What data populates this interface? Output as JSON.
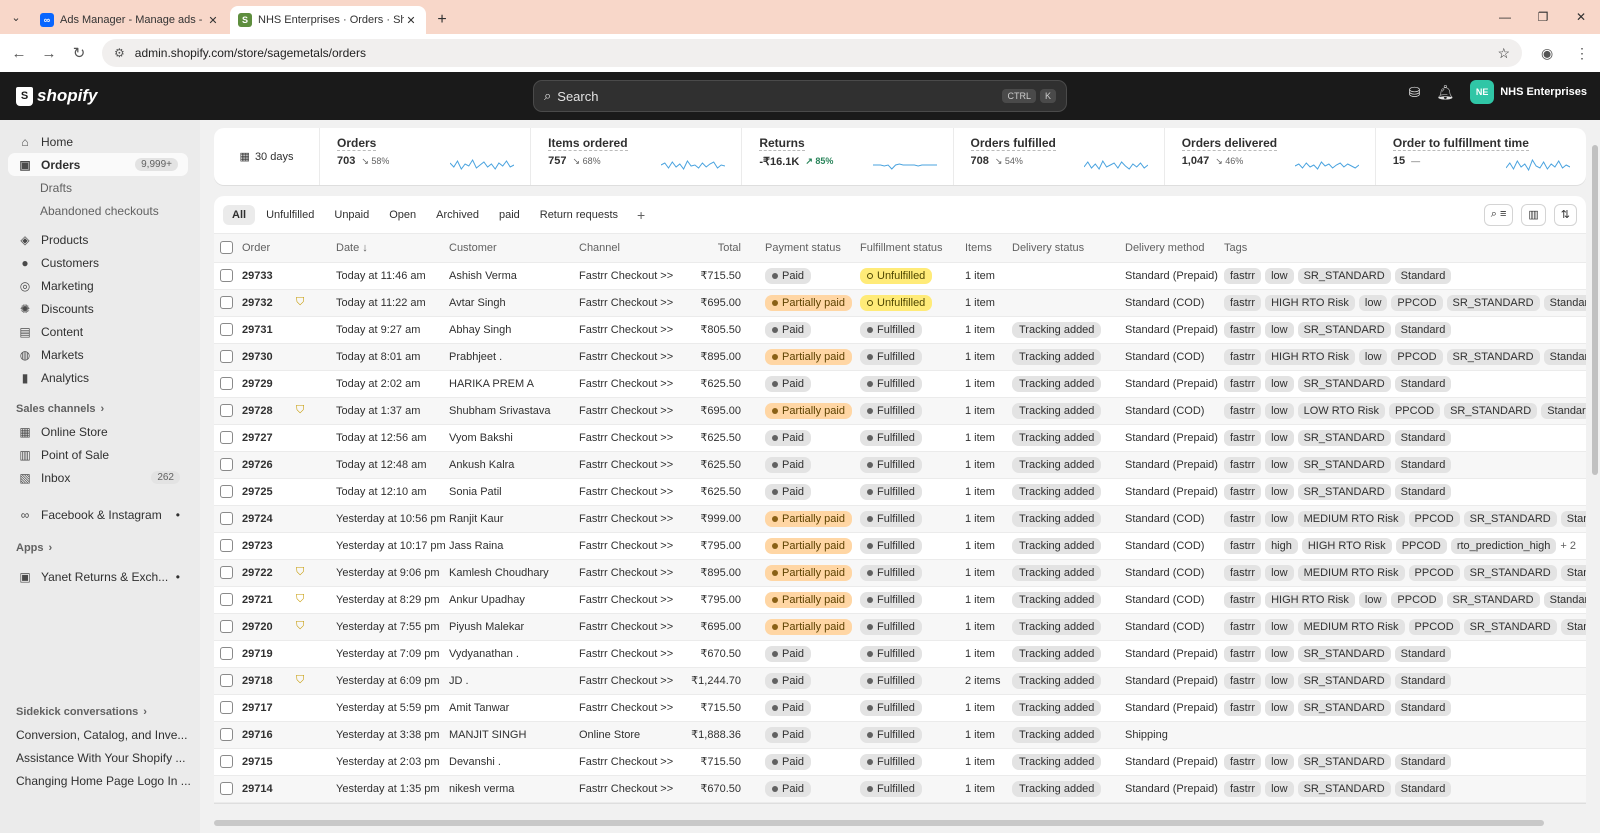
{
  "browser": {
    "tabs": [
      {
        "title": "Ads Manager - Manage ads - C",
        "active": false
      },
      {
        "title": "NHS Enterprises · Orders · Shop",
        "active": true
      }
    ],
    "url": "admin.shopify.com/store/sagemetals/orders"
  },
  "topbar": {
    "logo": "shopify",
    "search_placeholder": "Search",
    "kbd1": "CTRL",
    "kbd2": "K",
    "store_initials": "NE",
    "store_name": "NHS Enterprises"
  },
  "sidebar": {
    "home": "Home",
    "orders": "Orders",
    "orders_badge": "9,999+",
    "drafts": "Drafts",
    "abandoned": "Abandoned checkouts",
    "products": "Products",
    "customers": "Customers",
    "marketing": "Marketing",
    "discounts": "Discounts",
    "content": "Content",
    "markets": "Markets",
    "analytics": "Analytics",
    "sales_channels": "Sales channels",
    "online_store": "Online Store",
    "pos": "Point of Sale",
    "inbox": "Inbox",
    "inbox_badge": "262",
    "facebook": "Facebook & Instagram",
    "apps": "Apps",
    "yanet": "Yanet Returns & Exch...",
    "sidekick": "Sidekick conversations",
    "conv1": "Conversion, Catalog, and Inve...",
    "conv2": "Assistance With Your Shopify ...",
    "conv3": "Changing Home Page Logo In ..."
  },
  "metrics": {
    "range": "30 days",
    "items": [
      {
        "title": "Orders",
        "value": "703",
        "pct": "58%",
        "up": false
      },
      {
        "title": "Items ordered",
        "value": "757",
        "pct": "68%",
        "up": false
      },
      {
        "title": "Returns",
        "value": "-₹16.1K",
        "pct": "85%",
        "up": true
      },
      {
        "title": "Orders fulfilled",
        "value": "708",
        "pct": "54%",
        "up": false
      },
      {
        "title": "Orders delivered",
        "value": "1,047",
        "pct": "46%",
        "up": false
      },
      {
        "title": "Order to fulfillment time",
        "value": "15",
        "pct": "—",
        "up": false
      }
    ]
  },
  "filters": [
    "All",
    "Unfulfilled",
    "Unpaid",
    "Open",
    "Archived",
    "paid",
    "Return requests"
  ],
  "columns": {
    "order": "Order",
    "date": "Date ↓",
    "customer": "Customer",
    "channel": "Channel",
    "total": "Total",
    "payment": "Payment status",
    "fulfillment": "Fulfillment status",
    "items": "Items",
    "delivery": "Delivery status",
    "method": "Delivery method",
    "tags": "Tags"
  },
  "orders": [
    {
      "num": "29733",
      "flag": false,
      "date": "Today at 11:46 am",
      "customer": "Ashish Verma",
      "channel": "Fastrr Checkout >>",
      "total": "₹715.50",
      "payment": "Paid",
      "fulfillment": "Unfulfilled",
      "items": "1 item",
      "delivery": "",
      "method": "Standard (Prepaid)",
      "tags": [
        "fastrr",
        "low",
        "SR_STANDARD",
        "Standard"
      ],
      "more": ""
    },
    {
      "num": "29732",
      "flag": true,
      "date": "Today at 11:22 am",
      "customer": "Avtar Singh",
      "channel": "Fastrr Checkout >>",
      "total": "₹695.00",
      "payment": "Partially paid",
      "fulfillment": "Unfulfilled",
      "items": "1 item",
      "delivery": "",
      "method": "Standard (COD)",
      "tags": [
        "fastrr",
        "HIGH RTO Risk",
        "low",
        "PPCOD",
        "SR_STANDARD",
        "Standard"
      ],
      "more": ""
    },
    {
      "num": "29731",
      "flag": false,
      "date": "Today at 9:27 am",
      "customer": "Abhay Singh",
      "channel": "Fastrr Checkout >>",
      "total": "₹805.50",
      "payment": "Paid",
      "fulfillment": "Fulfilled",
      "items": "1 item",
      "delivery": "Tracking added",
      "method": "Standard (Prepaid)",
      "tags": [
        "fastrr",
        "low",
        "SR_STANDARD",
        "Standard"
      ],
      "more": ""
    },
    {
      "num": "29730",
      "flag": false,
      "date": "Today at 8:01 am",
      "customer": "Prabhjeet .",
      "channel": "Fastrr Checkout >>",
      "total": "₹895.00",
      "payment": "Partially paid",
      "fulfillment": "Fulfilled",
      "items": "1 item",
      "delivery": "Tracking added",
      "method": "Standard (COD)",
      "tags": [
        "fastrr",
        "HIGH RTO Risk",
        "low",
        "PPCOD",
        "SR_STANDARD",
        "Standard"
      ],
      "more": ""
    },
    {
      "num": "29729",
      "flag": false,
      "date": "Today at 2:02 am",
      "customer": "HARIKA PREM A",
      "channel": "Fastrr Checkout >>",
      "total": "₹625.50",
      "payment": "Paid",
      "fulfillment": "Fulfilled",
      "items": "1 item",
      "delivery": "Tracking added",
      "method": "Standard (Prepaid)",
      "tags": [
        "fastrr",
        "low",
        "SR_STANDARD",
        "Standard"
      ],
      "more": ""
    },
    {
      "num": "29728",
      "flag": true,
      "date": "Today at 1:37 am",
      "customer": "Shubham Srivastava",
      "channel": "Fastrr Checkout >>",
      "total": "₹695.00",
      "payment": "Partially paid",
      "fulfillment": "Fulfilled",
      "items": "1 item",
      "delivery": "Tracking added",
      "method": "Standard (COD)",
      "tags": [
        "fastrr",
        "low",
        "LOW RTO Risk",
        "PPCOD",
        "SR_STANDARD",
        "Standard"
      ],
      "more": ""
    },
    {
      "num": "29727",
      "flag": false,
      "date": "Today at 12:56 am",
      "customer": "Vyom Bakshi",
      "channel": "Fastrr Checkout >>",
      "total": "₹625.50",
      "payment": "Paid",
      "fulfillment": "Fulfilled",
      "items": "1 item",
      "delivery": "Tracking added",
      "method": "Standard (Prepaid)",
      "tags": [
        "fastrr",
        "low",
        "SR_STANDARD",
        "Standard"
      ],
      "more": ""
    },
    {
      "num": "29726",
      "flag": false,
      "date": "Today at 12:48 am",
      "customer": "Ankush Kalra",
      "channel": "Fastrr Checkout >>",
      "total": "₹625.50",
      "payment": "Paid",
      "fulfillment": "Fulfilled",
      "items": "1 item",
      "delivery": "Tracking added",
      "method": "Standard (Prepaid)",
      "tags": [
        "fastrr",
        "low",
        "SR_STANDARD",
        "Standard"
      ],
      "more": ""
    },
    {
      "num": "29725",
      "flag": false,
      "date": "Today at 12:10 am",
      "customer": "Sonia Patil",
      "channel": "Fastrr Checkout >>",
      "total": "₹625.50",
      "payment": "Paid",
      "fulfillment": "Fulfilled",
      "items": "1 item",
      "delivery": "Tracking added",
      "method": "Standard (Prepaid)",
      "tags": [
        "fastrr",
        "low",
        "SR_STANDARD",
        "Standard"
      ],
      "more": ""
    },
    {
      "num": "29724",
      "flag": false,
      "date": "Yesterday at 10:56 pm",
      "customer": "Ranjit Kaur",
      "channel": "Fastrr Checkout >>",
      "total": "₹999.00",
      "payment": "Partially paid",
      "fulfillment": "Fulfilled",
      "items": "1 item",
      "delivery": "Tracking added",
      "method": "Standard (COD)",
      "tags": [
        "fastrr",
        "low",
        "MEDIUM RTO Risk",
        "PPCOD",
        "SR_STANDARD",
        "Stand"
      ],
      "more": ""
    },
    {
      "num": "29723",
      "flag": false,
      "date": "Yesterday at 10:17 pm",
      "customer": "Jass Raina",
      "channel": "Fastrr Checkout >>",
      "total": "₹795.00",
      "payment": "Partially paid",
      "fulfillment": "Fulfilled",
      "items": "1 item",
      "delivery": "Tracking added",
      "method": "Standard (COD)",
      "tags": [
        "fastrr",
        "high",
        "HIGH RTO Risk",
        "PPCOD",
        "rto_prediction_high"
      ],
      "more": "+ 2"
    },
    {
      "num": "29722",
      "flag": true,
      "date": "Yesterday at 9:06 pm",
      "customer": "Kamlesh Choudhary",
      "channel": "Fastrr Checkout >>",
      "total": "₹895.00",
      "payment": "Partially paid",
      "fulfillment": "Fulfilled",
      "items": "1 item",
      "delivery": "Tracking added",
      "method": "Standard (COD)",
      "tags": [
        "fastrr",
        "low",
        "MEDIUM RTO Risk",
        "PPCOD",
        "SR_STANDARD",
        "Stand"
      ],
      "more": ""
    },
    {
      "num": "29721",
      "flag": true,
      "date": "Yesterday at 8:29 pm",
      "customer": "Ankur Upadhay",
      "channel": "Fastrr Checkout >>",
      "total": "₹795.00",
      "payment": "Partially paid",
      "fulfillment": "Fulfilled",
      "items": "1 item",
      "delivery": "Tracking added",
      "method": "Standard (COD)",
      "tags": [
        "fastrr",
        "HIGH RTO Risk",
        "low",
        "PPCOD",
        "SR_STANDARD",
        "Standard"
      ],
      "more": ""
    },
    {
      "num": "29720",
      "flag": true,
      "date": "Yesterday at 7:55 pm",
      "customer": "Piyush Malekar",
      "channel": "Fastrr Checkout >>",
      "total": "₹695.00",
      "payment": "Partially paid",
      "fulfillment": "Fulfilled",
      "items": "1 item",
      "delivery": "Tracking added",
      "method": "Standard (COD)",
      "tags": [
        "fastrr",
        "low",
        "MEDIUM RTO Risk",
        "PPCOD",
        "SR_STANDARD",
        "Stand"
      ],
      "more": ""
    },
    {
      "num": "29719",
      "flag": false,
      "date": "Yesterday at 7:09 pm",
      "customer": "Vydyanathan .",
      "channel": "Fastrr Checkout >>",
      "total": "₹670.50",
      "payment": "Paid",
      "fulfillment": "Fulfilled",
      "items": "1 item",
      "delivery": "Tracking added",
      "method": "Standard (Prepaid)",
      "tags": [
        "fastrr",
        "low",
        "SR_STANDARD",
        "Standard"
      ],
      "more": ""
    },
    {
      "num": "29718",
      "flag": true,
      "date": "Yesterday at 6:09 pm",
      "customer": "JD .",
      "channel": "Fastrr Checkout >>",
      "total": "₹1,244.70",
      "payment": "Paid",
      "fulfillment": "Fulfilled",
      "items": "2 items",
      "delivery": "Tracking added",
      "method": "Standard (Prepaid)",
      "tags": [
        "fastrr",
        "low",
        "SR_STANDARD",
        "Standard"
      ],
      "more": ""
    },
    {
      "num": "29717",
      "flag": false,
      "date": "Yesterday at 5:59 pm",
      "customer": "Amit Tanwar",
      "channel": "Fastrr Checkout >>",
      "total": "₹715.50",
      "payment": "Paid",
      "fulfillment": "Fulfilled",
      "items": "1 item",
      "delivery": "Tracking added",
      "method": "Standard (Prepaid)",
      "tags": [
        "fastrr",
        "low",
        "SR_STANDARD",
        "Standard"
      ],
      "more": ""
    },
    {
      "num": "29716",
      "flag": false,
      "date": "Yesterday at 3:38 pm",
      "customer": "MANJIT SINGH",
      "channel": "Online Store",
      "total": "₹1,888.36",
      "payment": "Paid",
      "fulfillment": "Fulfilled",
      "items": "1 item",
      "delivery": "Tracking added",
      "method": "Shipping",
      "tags": [],
      "more": ""
    },
    {
      "num": "29715",
      "flag": false,
      "date": "Yesterday at 2:03 pm",
      "customer": "Devanshi .",
      "channel": "Fastrr Checkout >>",
      "total": "₹715.50",
      "payment": "Paid",
      "fulfillment": "Fulfilled",
      "items": "1 item",
      "delivery": "Tracking added",
      "method": "Standard (Prepaid)",
      "tags": [
        "fastrr",
        "low",
        "SR_STANDARD",
        "Standard"
      ],
      "more": ""
    },
    {
      "num": "29714",
      "flag": false,
      "date": "Yesterday at 1:35 pm",
      "customer": "nikesh verma",
      "channel": "Fastrr Checkout >>",
      "total": "₹670.50",
      "payment": "Paid",
      "fulfillment": "Fulfilled",
      "items": "1 item",
      "delivery": "Tracking added",
      "method": "Standard (Prepaid)",
      "tags": [
        "fastrr",
        "low",
        "SR_STANDARD",
        "Standard"
      ],
      "more": ""
    }
  ]
}
